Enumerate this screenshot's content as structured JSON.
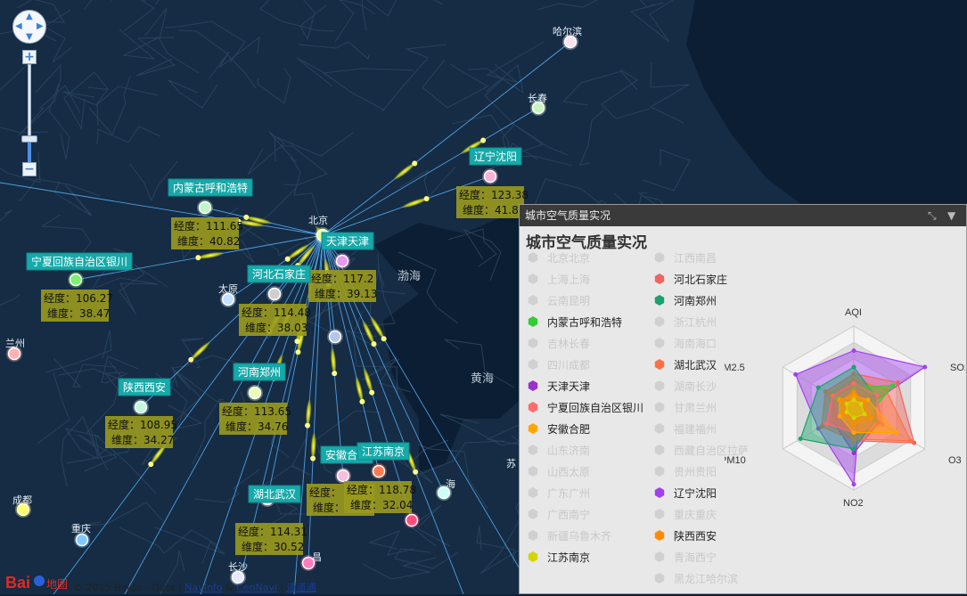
{
  "map": {
    "labels": [
      {
        "text": "哈尔滨"
      },
      {
        "text": "长春"
      },
      {
        "text": "北京"
      },
      {
        "text": "渤海"
      },
      {
        "text": "黄海"
      },
      {
        "text": "太原"
      },
      {
        "text": "兰州"
      },
      {
        "text": "成都"
      },
      {
        "text": "重庆"
      },
      {
        "text": "长沙"
      },
      {
        "text": "苏"
      },
      {
        "text": "海"
      },
      {
        "text": "昌"
      }
    ],
    "cities": [
      {
        "name": "辽宁沈阳",
        "lng": "经度：123.38",
        "lat": "维度：41.8"
      },
      {
        "name": "内蒙古呼和浩特",
        "lng": "经度：111.65",
        "lat": "维度：40.82"
      },
      {
        "name": "天津天津",
        "lng": "经度：117.2",
        "lat": "维度：39.13"
      },
      {
        "name": "宁夏回族自治区银川",
        "lng": "经度：106.27",
        "lat": "维度：38.47"
      },
      {
        "name": "河北石家庄",
        "lng": "经度：114.48",
        "lat": "维度：38.03"
      },
      {
        "name": "河南郑州",
        "lng": "经度：113.65",
        "lat": "维度：34.76"
      },
      {
        "name": "陕西西安",
        "lng": "经度：108.95",
        "lat": "维度：34.27"
      },
      {
        "name": "安徽合肥",
        "lng": "经度：",
        "lat": "维度："
      },
      {
        "name": "江苏南京",
        "lng": "经度：118.78",
        "lat": "维度：32.04"
      },
      {
        "name": "湖北武汉",
        "lng": "经度：114.31",
        "lat": "维度：30.52"
      }
    ],
    "copyright": {
      "text": "© 2015 Baidu - Data",
      "link1": "NavInfo",
      "sep": "&",
      "link2": "CenNavi",
      "link3": "道道通"
    },
    "logo": {
      "text": "地图"
    }
  },
  "panel": {
    "title": "城市空气质量实况",
    "heading": "城市空气质量实况",
    "legend_left": [
      {
        "label": "北京北京",
        "active": false,
        "color": "#cccccc"
      },
      {
        "label": "上海上海",
        "active": false,
        "color": "#cccccc"
      },
      {
        "label": "云南昆明",
        "active": false,
        "color": "#cccccc"
      },
      {
        "label": "内蒙古呼和浩特",
        "active": true,
        "color": "#32cd32"
      },
      {
        "label": "吉林长春",
        "active": false,
        "color": "#cccccc"
      },
      {
        "label": "四川成都",
        "active": false,
        "color": "#cccccc"
      },
      {
        "label": "天津天津",
        "active": true,
        "color": "#9932cc"
      },
      {
        "label": "宁夏回族自治区银川",
        "active": true,
        "color": "#ff6b6b"
      },
      {
        "label": "安徽合肥",
        "active": true,
        "color": "#ffa500"
      },
      {
        "label": "山东济南",
        "active": false,
        "color": "#cccccc"
      },
      {
        "label": "山西太原",
        "active": false,
        "color": "#cccccc"
      },
      {
        "label": "广东广州",
        "active": false,
        "color": "#cccccc"
      },
      {
        "label": "广西南宁",
        "active": false,
        "color": "#cccccc"
      },
      {
        "label": "新疆乌鲁木齐",
        "active": false,
        "color": "#cccccc"
      },
      {
        "label": "江苏南京",
        "active": true,
        "color": "#d4d400"
      }
    ],
    "legend_right": [
      {
        "label": "江西南昌",
        "active": false,
        "color": "#cccccc"
      },
      {
        "label": "河北石家庄",
        "active": true,
        "color": "#f0645f"
      },
      {
        "label": "河南郑州",
        "active": true,
        "color": "#1aa36c"
      },
      {
        "label": "浙江杭州",
        "active": false,
        "color": "#cccccc"
      },
      {
        "label": "海南海口",
        "active": false,
        "color": "#cccccc"
      },
      {
        "label": "湖北武汉",
        "active": true,
        "color": "#ff7043"
      },
      {
        "label": "湖南长沙",
        "active": false,
        "color": "#cccccc"
      },
      {
        "label": "甘肃兰州",
        "active": false,
        "color": "#cccccc"
      },
      {
        "label": "福建福州",
        "active": false,
        "color": "#cccccc"
      },
      {
        "label": "西藏自治区拉萨",
        "active": false,
        "color": "#cccccc"
      },
      {
        "label": "贵州贵阳",
        "active": false,
        "color": "#cccccc"
      },
      {
        "label": "辽宁沈阳",
        "active": true,
        "color": "#a43ff0"
      },
      {
        "label": "重庆重庆",
        "active": false,
        "color": "#cccccc"
      },
      {
        "label": "陕西西安",
        "active": true,
        "color": "#ff8c00"
      },
      {
        "label": "青海西宁",
        "active": false,
        "color": "#cccccc"
      },
      {
        "label": "黑龙江哈尔滨",
        "active": false,
        "color": "#cccccc"
      }
    ],
    "radar_axes": [
      "AQI",
      "SO2",
      "O3",
      "NO2",
      "PM10",
      "PM2.5"
    ]
  },
  "chart_data": {
    "type": "radar",
    "indicators": [
      "AQI",
      "SO2",
      "O3",
      "NO2",
      "PM10",
      "PM2.5"
    ],
    "series": [
      {
        "name": "辽宁沈阳",
        "color": "#a43ff0",
        "values": [
          0.7,
          1.0,
          0.08,
          0.93,
          0.5,
          0.82
        ]
      },
      {
        "name": "天津天津",
        "color": "#9932cc",
        "values": [
          0.3,
          0.25,
          0.35,
          0.55,
          0.3,
          0.3
        ]
      },
      {
        "name": "河北石家庄",
        "color": "#f0645f",
        "values": [
          0.42,
          0.62,
          0.85,
          0.4,
          0.45,
          0.4
        ]
      },
      {
        "name": "湖北武汉",
        "color": "#ff7043",
        "values": [
          0.35,
          0.45,
          0.8,
          0.38,
          0.3,
          0.35
        ]
      },
      {
        "name": "河南郑州",
        "color": "#1aa36c",
        "values": [
          0.5,
          0.3,
          0.3,
          0.5,
          0.75,
          0.5
        ]
      },
      {
        "name": "内蒙古呼和浩特",
        "color": "#32cd32",
        "values": [
          0.25,
          0.55,
          0.2,
          0.2,
          0.2,
          0.25
        ]
      },
      {
        "name": "宁夏回族自治区银川",
        "color": "#ff6b6b",
        "values": [
          0.3,
          0.32,
          0.4,
          0.3,
          0.38,
          0.3
        ]
      },
      {
        "name": "安徽合肥",
        "color": "#ffa500",
        "values": [
          0.15,
          0.2,
          0.6,
          0.3,
          0.2,
          0.2
        ]
      },
      {
        "name": "陕西西安",
        "color": "#ff8c00",
        "values": [
          0.2,
          0.15,
          0.25,
          0.2,
          0.15,
          0.18
        ]
      },
      {
        "name": "江苏南京",
        "color": "#d4d400",
        "values": [
          0.1,
          0.1,
          0.15,
          0.12,
          0.1,
          0.1
        ]
      }
    ]
  },
  "controls": {
    "zoom_in": "+",
    "zoom_out": "−"
  }
}
